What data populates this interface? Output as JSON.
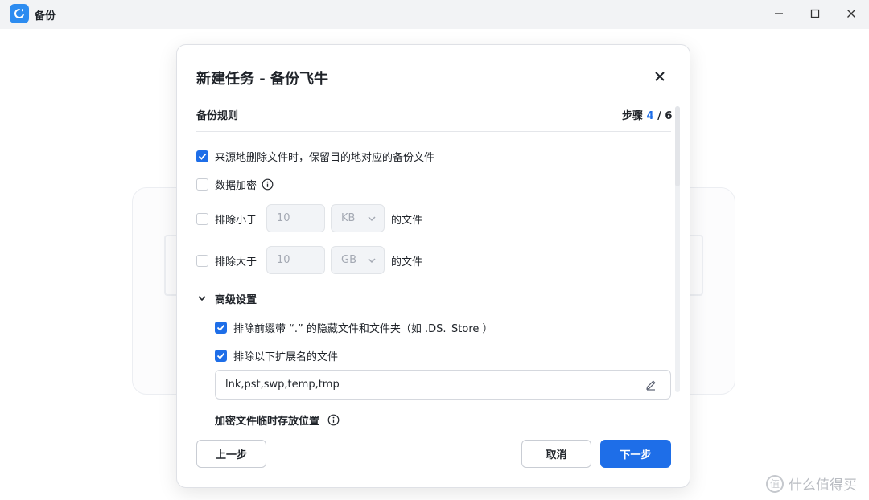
{
  "window": {
    "title": "备份",
    "controls": [
      "minimize-icon",
      "maximize-icon",
      "close-icon"
    ]
  },
  "dialog": {
    "title": "新建任务 - 备份飞牛",
    "section_title": "备份规则",
    "step_prefix": "步骤 ",
    "step_current": "4",
    "step_total": " / 6",
    "options": {
      "keep_deleted": {
        "label": "来源地删除文件时，保留目的地对应的备份文件",
        "checked": true
      },
      "encrypt": {
        "label": "数据加密",
        "checked": false
      },
      "exclude_smaller": {
        "label": "排除小于",
        "checked": false,
        "value": "10",
        "unit": "KB",
        "suffix": "的文件"
      },
      "exclude_larger": {
        "label": "排除大于",
        "checked": false,
        "value": "10",
        "unit": "GB",
        "suffix": "的文件"
      }
    },
    "advanced": {
      "title": "高级设置",
      "expanded": true,
      "exclude_hidden": {
        "label": "排除前缀带 “.” 的隐藏文件和文件夹（如 .DS._Store ）",
        "checked": true
      },
      "exclude_ext": {
        "label": "排除以下扩展名的文件",
        "checked": true
      },
      "extensions_value": "lnk,pst,swp,temp,tmp",
      "temp_location_title": "加密文件临时存放位置"
    },
    "buttons": {
      "prev": "上一步",
      "cancel": "取消",
      "next": "下一步"
    }
  },
  "watermark": "什么值得买",
  "colors": {
    "accent": "#1e6ee8",
    "app_icon": "#2d8cf0"
  }
}
